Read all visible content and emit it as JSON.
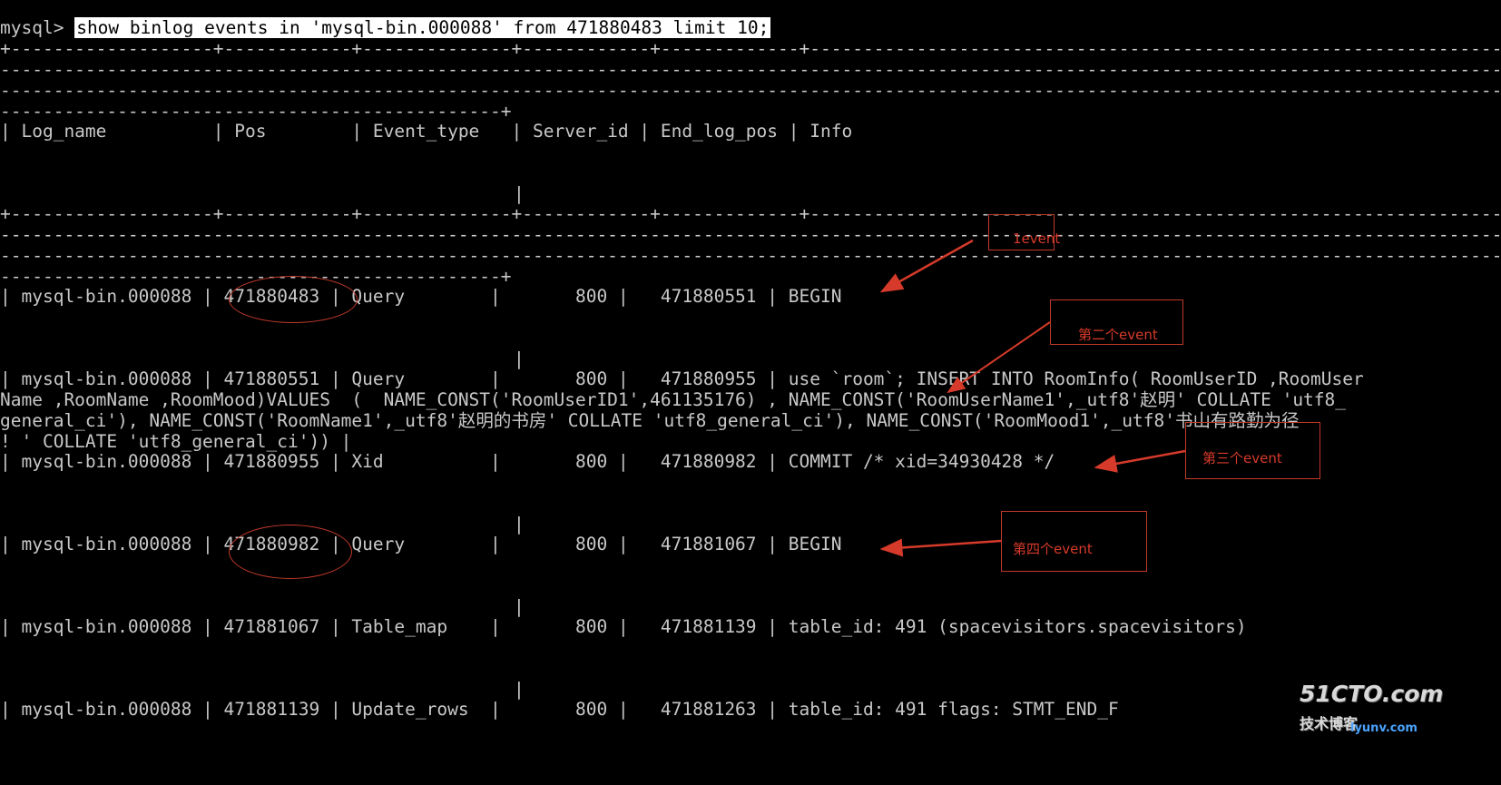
{
  "terminal": {
    "prompt": "mysql>",
    "command": "show binlog events in 'mysql-bin.000088' from 471880483 limit 10;",
    "border_line": "+-------------------+------------+--------------+------------+-------------+------------------------------------------------------------------------------------------------------------------------------------------------------",
    "dash_line": "-----------------------------------------------------------------------------------------------------------------------------------------------------------------------------------------------------------------------------------------------------------",
    "dash_end_line": "-----------------------------------------------+",
    "header": "| Log_name          | Pos        | Event_type   | Server_id | End_log_pos | Info",
    "pipe": "|",
    "rows": [
      "| mysql-bin.000088 | 471880483 | Query        |       800 |   471880551 | BEGIN",
      "| mysql-bin.000088 | 471880551 | Query        |       800 |   471880955 | use `room`; INSERT INTO RoomInfo( RoomUserID ,RoomUser",
      "Name ,RoomName ,RoomMood)VALUES  (  NAME_CONST('RoomUserID1',461135176) , NAME_CONST('RoomUserName1',_utf8'赵明' COLLATE 'utf8_",
      "general_ci'), NAME_CONST('RoomName1',_utf8'赵明的书房' COLLATE 'utf8_general_ci'), NAME_CONST('RoomMood1',_utf8'书山有路勤为径",
      "! ' COLLATE 'utf8_general_ci')) |",
      "| mysql-bin.000088 | 471880955 | Xid          |       800 |   471880982 | COMMIT /* xid=34930428 */",
      "| mysql-bin.000088 | 471880982 | Query        |       800 |   471881067 | BEGIN",
      "| mysql-bin.000088 | 471881067 | Table_map    |       800 |   471881139 | table_id: 491 (spacevisitors.spacevisitors)",
      "| mysql-bin.000088 | 471881139 | Update_rows  |       800 |   471881263 | table_id: 491 flags: STMT_END_F"
    ]
  },
  "annotations": {
    "event1": "1event",
    "event2": "第二个event",
    "event3": "第三个event",
    "event4": "第四个event"
  },
  "watermark": {
    "logo": "51CTO.com",
    "sub": "技术博客",
    "url": "lyunv.com"
  },
  "colors": {
    "background": "#000000",
    "text": "#c8c8c8",
    "annotation": "#c0392b"
  }
}
